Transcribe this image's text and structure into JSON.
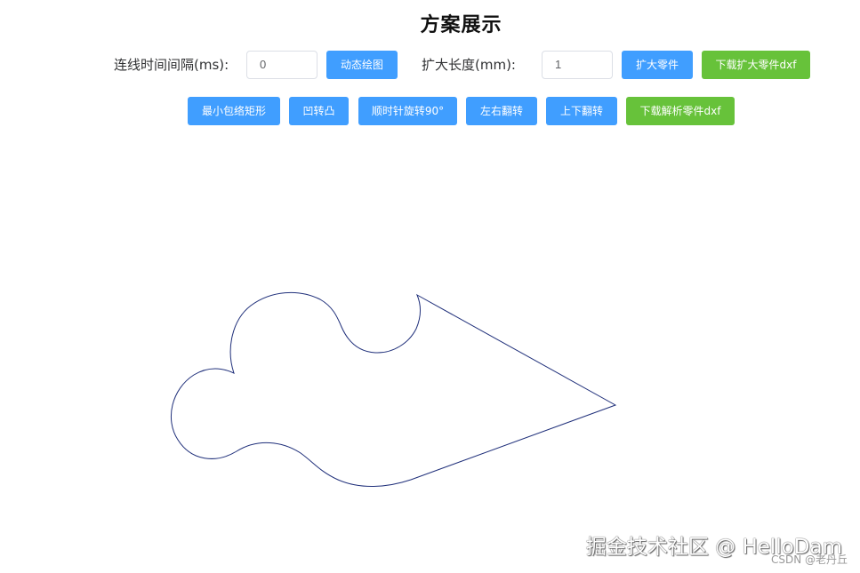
{
  "title": "方案展示",
  "controls": {
    "interval_label": "连线时间间隔(ms):",
    "interval_value": "0",
    "draw_button": "动态绘图",
    "expand_label": "扩大长度(mm):",
    "expand_value": "1",
    "expand_button": "扩大零件",
    "download_expanded_button": "下载扩大零件dxf"
  },
  "actions": {
    "min_bbox_button": "最小包络矩形",
    "concave_convex_button": "凹转凸",
    "rotate_button": "顺时针旋转90°",
    "flip_lr_button": "左右翻转",
    "flip_ud_button": "上下翻转",
    "download_parsed_button": "下载解析零件dxf"
  },
  "colors": {
    "primary": "#409eff",
    "success": "#67c23a",
    "shape_stroke": "#1f2f7a"
  },
  "watermark": {
    "main": "掘金技术社区 @ HelloDam",
    "sub": "CSDN @老丹丘"
  }
}
